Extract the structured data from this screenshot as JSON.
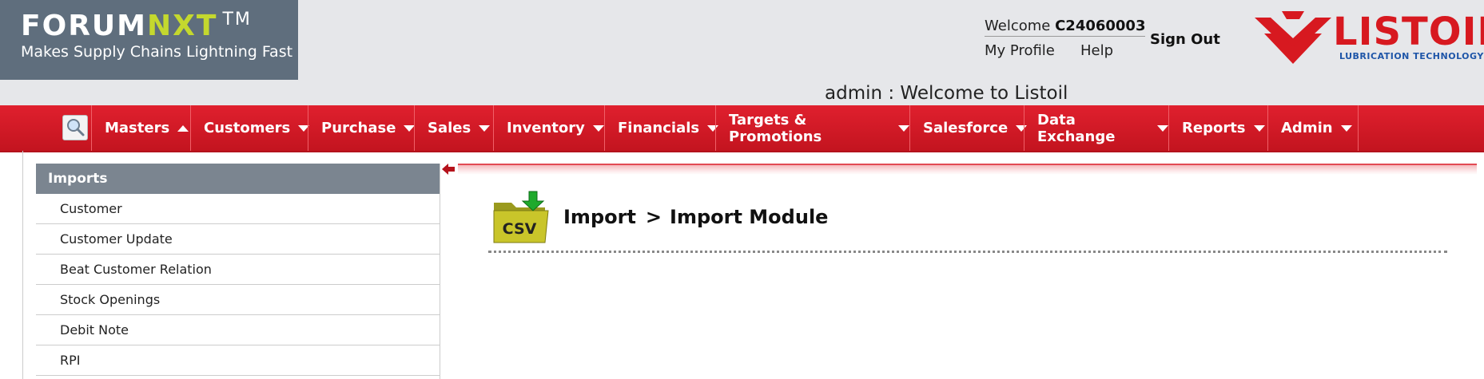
{
  "brand": {
    "name_part1": "FORUM",
    "name_part2": "NXT",
    "trademark": "TM",
    "tagline": "Makes Supply Chains Lightning Fast"
  },
  "user": {
    "welcome_label": "Welcome",
    "user_id": "C24060003",
    "my_profile": "My Profile",
    "help": "Help",
    "sign_out": "Sign Out"
  },
  "logo": {
    "name": "LISTOIL",
    "subtitle": "LUBRICATION TECHNOLOGY"
  },
  "page_title": "admin : Welcome to Listoil",
  "nav": {
    "search_icon": "search-icon",
    "items": [
      {
        "label": "Masters",
        "caret": "up"
      },
      {
        "label": "Customers",
        "caret": "down"
      },
      {
        "label": "Purchase",
        "caret": "down"
      },
      {
        "label": "Sales",
        "caret": "down"
      },
      {
        "label": "Inventory",
        "caret": "down"
      },
      {
        "label": "Financials",
        "caret": "down"
      },
      {
        "label": "Targets & Promotions",
        "caret": "down"
      },
      {
        "label": "Salesforce",
        "caret": "down"
      },
      {
        "label": "Data Exchange",
        "caret": "down"
      },
      {
        "label": "Reports",
        "caret": "down"
      },
      {
        "label": "Admin",
        "caret": "down"
      }
    ]
  },
  "sidebar": {
    "heading": "Imports",
    "items": [
      {
        "label": "Customer"
      },
      {
        "label": "Customer Update"
      },
      {
        "label": "Beat Customer Relation"
      },
      {
        "label": "Stock Openings"
      },
      {
        "label": "Debit Note"
      },
      {
        "label": "RPI"
      }
    ]
  },
  "main": {
    "icon_label": "CSV",
    "breadcrumb_root": "Import",
    "breadcrumb_sep": ">",
    "breadcrumb_current": "Import Module"
  },
  "colors": {
    "nav_red": "#d71920",
    "brand_bg": "#5f6e7d",
    "accent_green": "#c4d82e",
    "logo_blue": "#1e55a8"
  }
}
